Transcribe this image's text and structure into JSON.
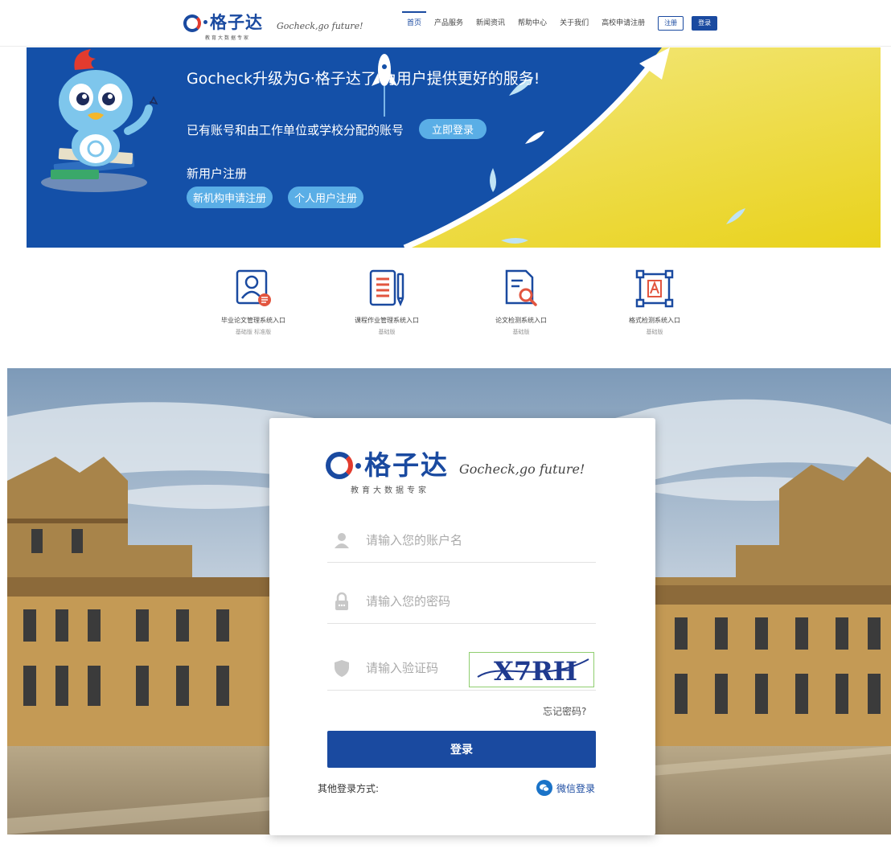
{
  "nav": {
    "logo_cn": "格子达",
    "logo_sub": "教育大数据专家",
    "slogan": "Gocheck,go future!",
    "menu": [
      "首页",
      "产品服务",
      "新闻资讯",
      "帮助中心",
      "关于我们",
      "高校申请注册"
    ],
    "register_label": "注册",
    "login_label": "登录"
  },
  "banner": {
    "title": "Gocheck升级为G·格子达了 为用户提供更好的服务!",
    "line2": "已有账号和由工作单位或学校分配的账号",
    "login_now": "立即登录",
    "new_user": "新用户注册",
    "org_register": "新机构申请注册",
    "personal_register": "个人用户注册"
  },
  "entries": [
    {
      "label": "毕业论文管理系统入口",
      "sub": "基础版   标准版",
      "icon": "thesis-user-icon"
    },
    {
      "label": "课程作业管理系统入口",
      "sub": "基础版",
      "icon": "document-pen-icon"
    },
    {
      "label": "论文检测系统入口",
      "sub": "基础版",
      "icon": "document-search-icon"
    },
    {
      "label": "格式检测系统入口",
      "sub": "基础版",
      "icon": "format-frame-icon"
    }
  ],
  "login": {
    "logo_cn": "格子达",
    "logo_sub": "教育大数据专家",
    "slogan": "Gocheck,go future!",
    "username_placeholder": "请输入您的账户名",
    "password_placeholder": "请输入您的密码",
    "captcha_placeholder": "请输入验证码",
    "captcha_text": "X7RH",
    "forgot": "忘记密码?",
    "submit": "登录",
    "other_methods": "其他登录方式:",
    "wechat": "微信登录"
  },
  "colors": {
    "brand": "#1a4aa0",
    "accent_red": "#e23b2e",
    "banner_pill": "#5aaee6",
    "banner_yellow": "#e8d52a"
  }
}
